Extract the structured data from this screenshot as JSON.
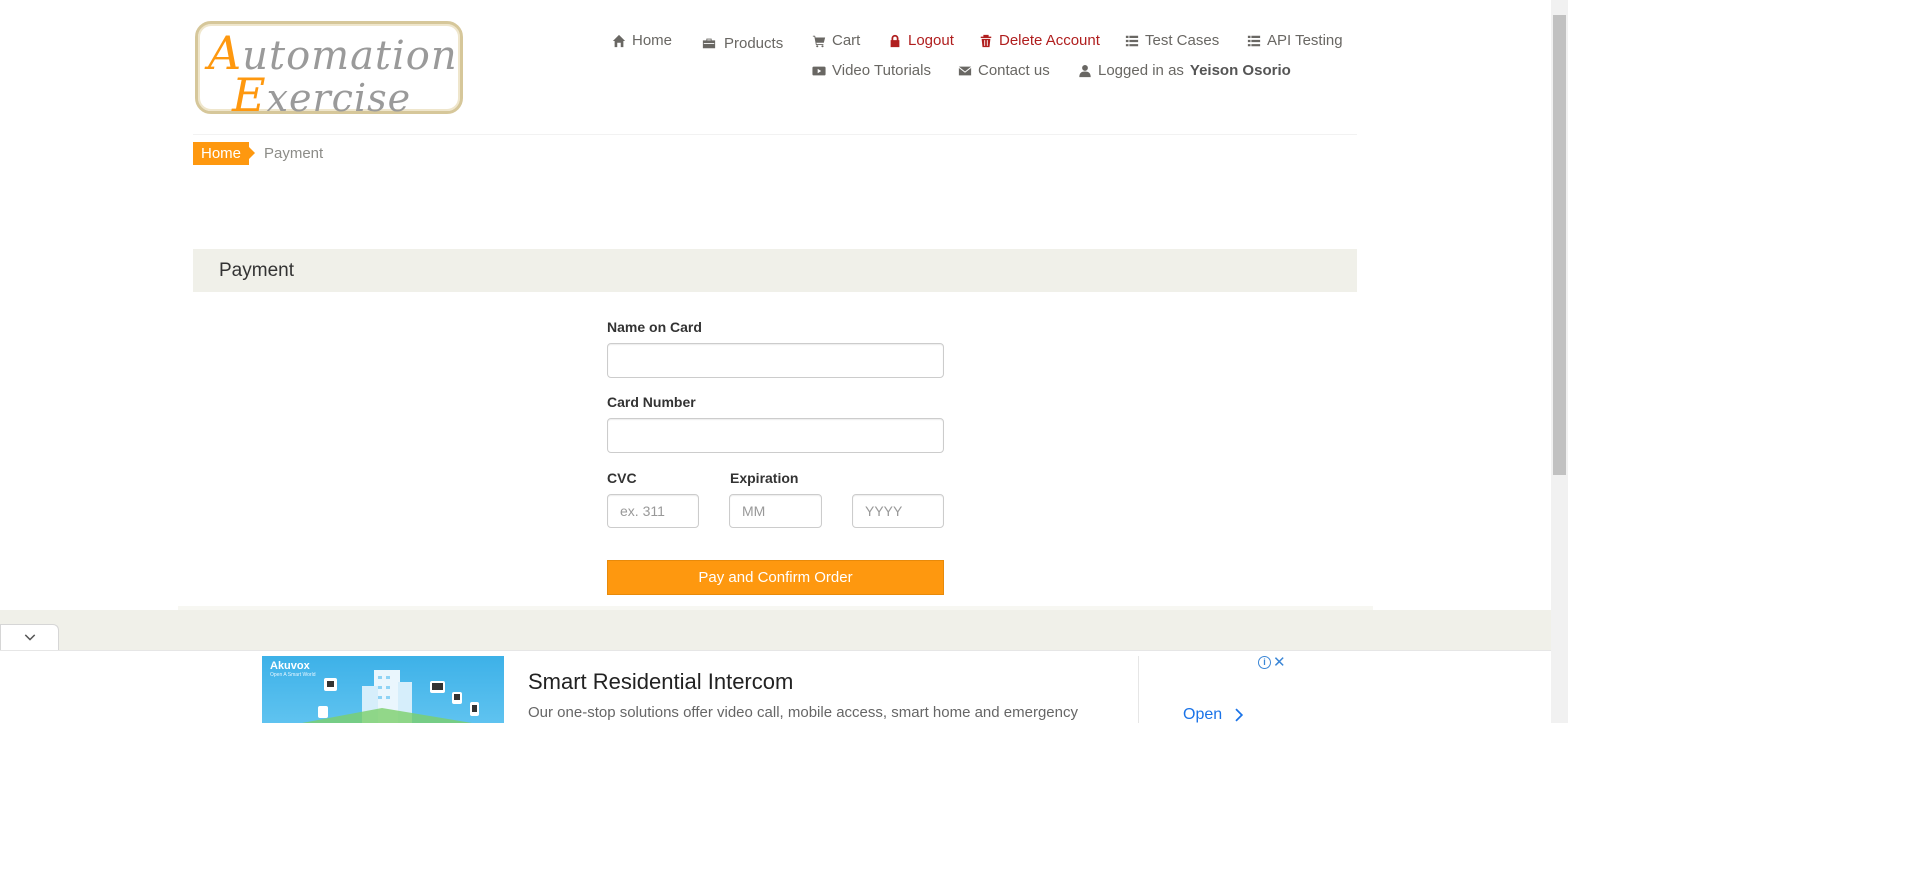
{
  "logo": {
    "line1_cap": "A",
    "line1_rest": "utomation",
    "line2_cap": "E",
    "line2_rest": "xercise"
  },
  "nav": {
    "home": "Home",
    "products": "Products",
    "cart": "Cart",
    "logout": "Logout",
    "delete_account": "Delete Account",
    "test_cases": "Test Cases",
    "api_testing": "API Testing",
    "video_tutorials": "Video Tutorials",
    "contact_us": "Contact us",
    "logged_in_prefix": "Logged in as",
    "logged_in_user": "Yeison Osorio"
  },
  "breadcrumb": {
    "home": "Home",
    "current": "Payment"
  },
  "payment": {
    "heading": "Payment",
    "name_label": "Name on Card",
    "name_value": "",
    "card_label": "Card Number",
    "card_value": "",
    "cvc_label": "CVC",
    "cvc_placeholder": "ex. 311",
    "expiration_label": "Expiration",
    "month_placeholder": "MM",
    "year_placeholder": "YYYY",
    "submit_label": "Pay and Confirm Order"
  },
  "colors": {
    "accent": "#fe980f",
    "danger": "#b01e1e",
    "panel": "#f0f0e9"
  },
  "ad": {
    "brand": "Akuvox",
    "brand_tagline": "Open A Smart World",
    "title": "Smart Residential Intercom",
    "description": "Our one-stop solutions offer video call, mobile access, smart home and emergency",
    "cta": "Open",
    "info_glyph": "i",
    "close_glyph": "✕"
  }
}
